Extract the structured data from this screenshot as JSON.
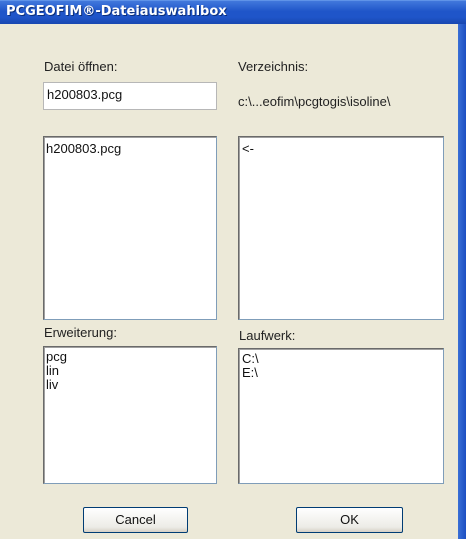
{
  "window": {
    "title": "PCGEOFIM®-Dateiauswahlbox"
  },
  "file_open": {
    "label": "Datei öffnen:",
    "value": "h200803.pcg"
  },
  "directory": {
    "label": "Verzeichnis:",
    "path": "c:\\...eofim\\pcgtogis\\isoline\\"
  },
  "file_list": {
    "items": [
      "h200803.pcg"
    ]
  },
  "dir_list": {
    "items": [
      "<-"
    ]
  },
  "extension": {
    "label": "Erweiterung:",
    "items": [
      "pcg",
      "lin",
      "liv"
    ]
  },
  "drive": {
    "label": "Laufwerk:",
    "items": [
      "C:\\",
      "E:\\"
    ]
  },
  "buttons": {
    "cancel": "Cancel",
    "ok": "OK"
  }
}
